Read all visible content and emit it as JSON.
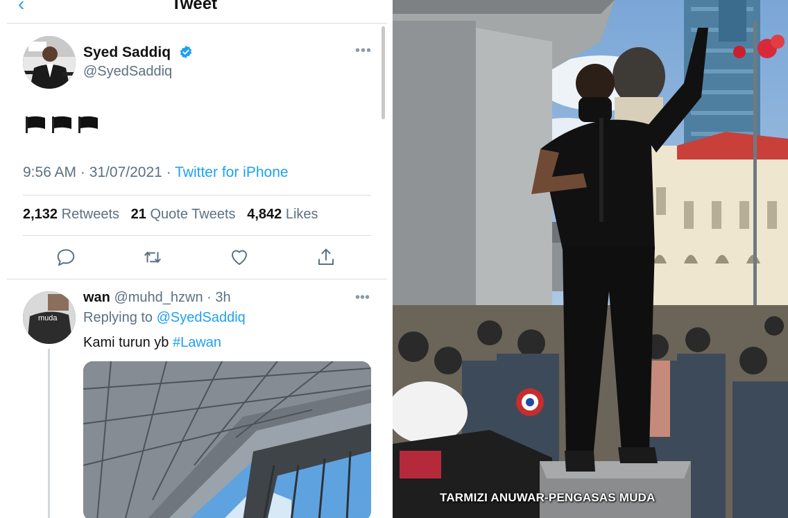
{
  "header": {
    "title": "Tweet"
  },
  "tweet": {
    "author_name": "Syed Saddiq",
    "author_handle": "@SyedSaddiq",
    "content": "🏴🏴🏴",
    "time": "9:56 AM",
    "date": "31/07/2021",
    "source": "Twitter for iPhone",
    "retweets_count": "2,132",
    "retweets_label": "Retweets",
    "quotes_count": "21",
    "quotes_label": "Quote Tweets",
    "likes_count": "4,842",
    "likes_label": "Likes"
  },
  "reply": {
    "author_name": "wan",
    "author_handle": "@muhd_hzwn",
    "age": "3h",
    "replying_prefix": "Replying to",
    "replying_to": "@SyedSaddiq",
    "text": "Kami turun yb",
    "hashtag": "#Lawan",
    "avatar_shirt_text": "muda"
  },
  "photo": {
    "caption": "TARMIZI ANUWAR-PENGASAS MUDA"
  },
  "icons": {
    "reply": "reply-icon",
    "retweet": "retweet-icon",
    "like": "heart-icon",
    "share": "share-icon",
    "verified": "verified-badge-icon",
    "more": "more-icon",
    "back": "back-chevron-icon"
  },
  "colors": {
    "accent": "#1da1f2",
    "secondary_text": "#5b7083",
    "primary_text": "#111111"
  }
}
